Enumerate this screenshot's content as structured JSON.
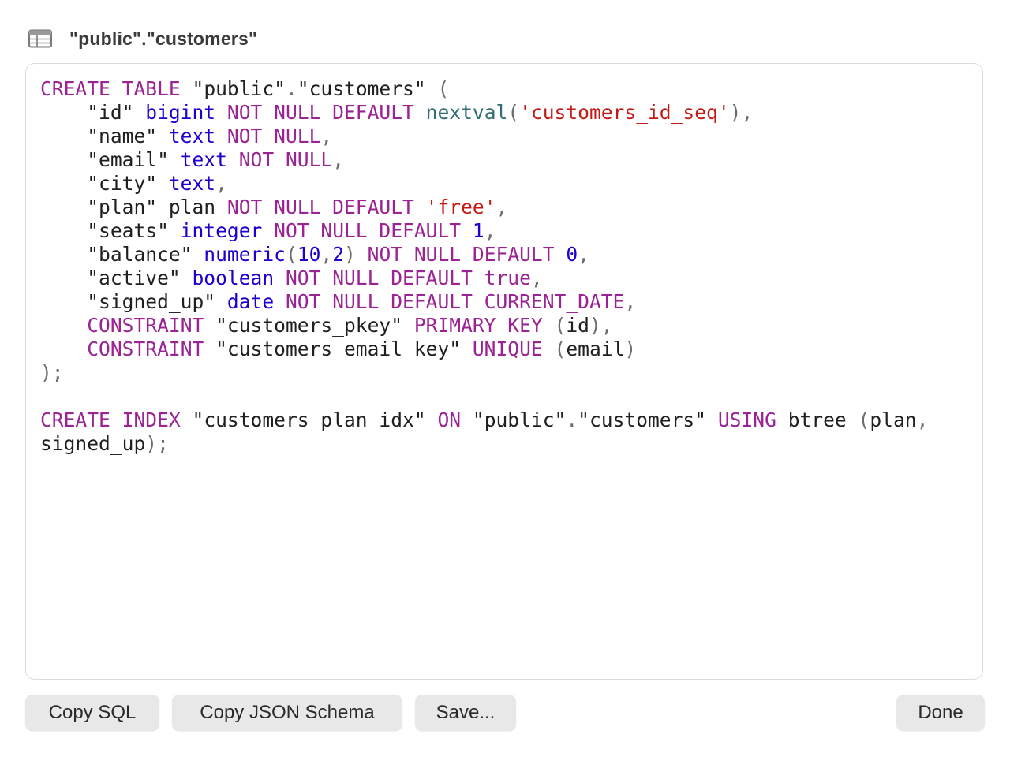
{
  "window": {
    "title": "\"public\".\"customers\"",
    "icon": "table-icon"
  },
  "editor": {
    "language": "sql",
    "lines": [
      [
        [
          "kw",
          "CREATE"
        ],
        [
          "id",
          " "
        ],
        [
          "kw",
          "TABLE"
        ],
        [
          "id",
          " \"public\""
        ],
        [
          "pun",
          "."
        ],
        [
          "id",
          "\"customers\" "
        ],
        [
          "pun",
          "("
        ]
      ],
      [
        [
          "id",
          "    \"id\" "
        ],
        [
          "type",
          "bigint"
        ],
        [
          "id",
          " "
        ],
        [
          "kw",
          "NOT NULL DEFAULT"
        ],
        [
          "id",
          " "
        ],
        [
          "fn",
          "nextval"
        ],
        [
          "pun",
          "("
        ],
        [
          "str",
          "'customers_id_seq'"
        ],
        [
          "pun",
          "),"
        ]
      ],
      [
        [
          "id",
          "    \"name\" "
        ],
        [
          "type",
          "text"
        ],
        [
          "id",
          " "
        ],
        [
          "kw",
          "NOT NULL"
        ],
        [
          "pun",
          ","
        ]
      ],
      [
        [
          "id",
          "    \"email\" "
        ],
        [
          "type",
          "text"
        ],
        [
          "id",
          " "
        ],
        [
          "kw",
          "NOT NULL"
        ],
        [
          "pun",
          ","
        ]
      ],
      [
        [
          "id",
          "    \"city\" "
        ],
        [
          "type",
          "text"
        ],
        [
          "pun",
          ","
        ]
      ],
      [
        [
          "id",
          "    \"plan\" plan "
        ],
        [
          "kw",
          "NOT NULL DEFAULT"
        ],
        [
          "id",
          " "
        ],
        [
          "str",
          "'free'"
        ],
        [
          "pun",
          ","
        ]
      ],
      [
        [
          "id",
          "    \"seats\" "
        ],
        [
          "type",
          "integer"
        ],
        [
          "id",
          " "
        ],
        [
          "kw",
          "NOT NULL DEFAULT"
        ],
        [
          "id",
          " "
        ],
        [
          "num",
          "1"
        ],
        [
          "pun",
          ","
        ]
      ],
      [
        [
          "id",
          "    \"balance\" "
        ],
        [
          "type",
          "numeric"
        ],
        [
          "pun",
          "("
        ],
        [
          "num",
          "10"
        ],
        [
          "pun",
          ","
        ],
        [
          "num",
          "2"
        ],
        [
          "pun",
          ")"
        ],
        [
          "id",
          " "
        ],
        [
          "kw",
          "NOT NULL DEFAULT"
        ],
        [
          "id",
          " "
        ],
        [
          "num",
          "0"
        ],
        [
          "pun",
          ","
        ]
      ],
      [
        [
          "id",
          "    \"active\" "
        ],
        [
          "type",
          "boolean"
        ],
        [
          "id",
          " "
        ],
        [
          "kw",
          "NOT NULL DEFAULT true"
        ],
        [
          "pun",
          ","
        ]
      ],
      [
        [
          "id",
          "    \"signed_up\" "
        ],
        [
          "type",
          "date"
        ],
        [
          "id",
          " "
        ],
        [
          "kw",
          "NOT NULL DEFAULT CURRENT_DATE"
        ],
        [
          "pun",
          ","
        ]
      ],
      [
        [
          "id",
          "    "
        ],
        [
          "kw",
          "CONSTRAINT"
        ],
        [
          "id",
          " \"customers_pkey\" "
        ],
        [
          "kw",
          "PRIMARY KEY"
        ],
        [
          "id",
          " "
        ],
        [
          "pun",
          "("
        ],
        [
          "id",
          "id"
        ],
        [
          "pun",
          "),"
        ]
      ],
      [
        [
          "id",
          "    "
        ],
        [
          "kw",
          "CONSTRAINT"
        ],
        [
          "id",
          " \"customers_email_key\" "
        ],
        [
          "kw",
          "UNIQUE"
        ],
        [
          "id",
          " "
        ],
        [
          "pun",
          "("
        ],
        [
          "id",
          "email"
        ],
        [
          "pun",
          ")"
        ]
      ],
      [
        [
          "pun",
          ");"
        ]
      ],
      [
        [
          "id",
          ""
        ]
      ],
      [
        [
          "kw",
          "CREATE"
        ],
        [
          "id",
          " "
        ],
        [
          "kw",
          "INDEX"
        ],
        [
          "id",
          " \"customers_plan_idx\" "
        ],
        [
          "kw",
          "ON"
        ],
        [
          "id",
          " \"public\""
        ],
        [
          "pun",
          "."
        ],
        [
          "id",
          "\"customers\" "
        ],
        [
          "kw",
          "USING"
        ],
        [
          "id",
          " btree "
        ],
        [
          "pun",
          "("
        ],
        [
          "id",
          "plan"
        ],
        [
          "pun",
          ","
        ]
      ],
      [
        [
          "id",
          "signed_up"
        ],
        [
          "pun",
          ");"
        ]
      ]
    ]
  },
  "buttons": {
    "copy_sql": "Copy SQL",
    "copy_json_schema": "Copy JSON Schema",
    "save": "Save...",
    "done": "Done"
  },
  "colors": {
    "keyword": "#9b2393",
    "type": "#1c00cf",
    "function": "#326d74",
    "string": "#c41a16",
    "number": "#1c00cf",
    "punctuation": "#6c6c6c",
    "identifier": "#1f1f1f",
    "button_bg": "#e8e8e8",
    "editor_border": "#dcdcdc"
  }
}
